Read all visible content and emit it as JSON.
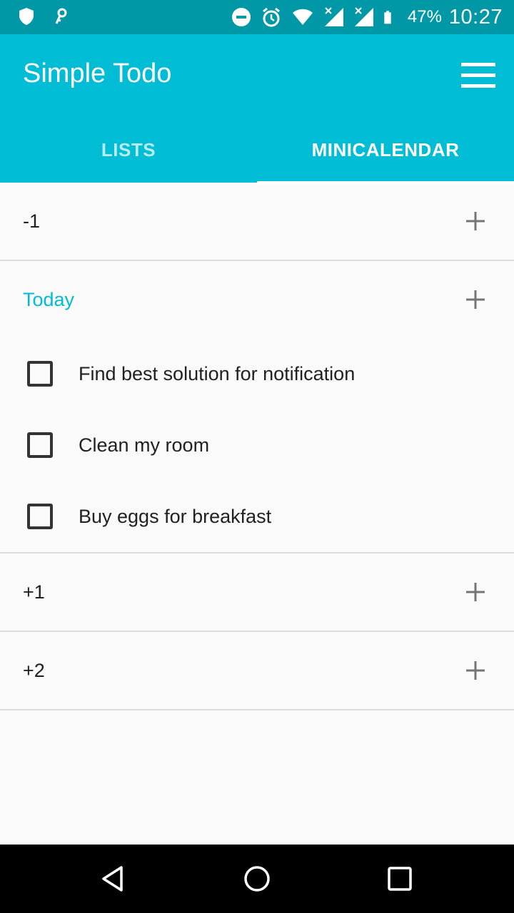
{
  "status_bar": {
    "battery_percent": "47%",
    "time": "10:27",
    "icons": [
      "shield-icon",
      "key-icon",
      "dnd-icon",
      "alarm-icon",
      "wifi-icon",
      "signal-icon",
      "signal-icon",
      "battery-icon"
    ]
  },
  "app_bar": {
    "title": "Simple Todo",
    "menu_icon": "hamburger-menu-icon",
    "tabs": [
      {
        "label": "LISTS",
        "selected": false
      },
      {
        "label": "MINICALENDAR",
        "selected": true
      }
    ]
  },
  "calendar": {
    "days": [
      {
        "label": "-1",
        "tasks": []
      },
      {
        "label": "Today",
        "highlight": true,
        "tasks": [
          {
            "text": "Find best solution for notification",
            "checked": false
          },
          {
            "text": "Clean my room",
            "checked": false
          },
          {
            "text": "Buy eggs for breakfast",
            "checked": false
          }
        ]
      },
      {
        "label": "+1",
        "tasks": []
      },
      {
        "label": "+2",
        "tasks": []
      }
    ]
  },
  "colors": {
    "primary": "#00bcd4",
    "primary_dark": "#0097a7",
    "accent_text": "#00bcd4"
  },
  "nav_bar": {
    "buttons": [
      "back-icon",
      "home-icon",
      "recents-icon"
    ]
  }
}
